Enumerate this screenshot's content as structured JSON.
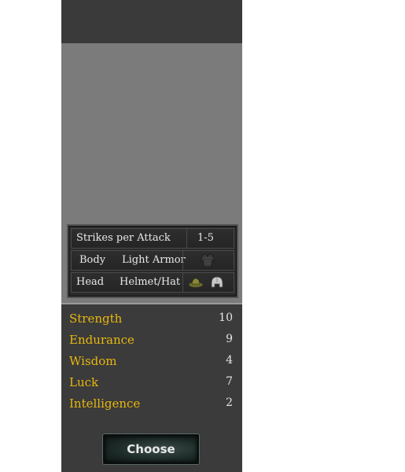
{
  "equipment": {
    "strikes_label": "Strikes per Attack",
    "strikes_value": "1-5",
    "body_slot": "Body",
    "body_item": "Light Armor",
    "head_slot": "Head",
    "head_item": "Helmet/Hat",
    "body_icon": "light-armor-icon",
    "head_icons": [
      "hat-icon",
      "helmet-icon"
    ]
  },
  "stats": [
    {
      "label": "Strength",
      "value": "10"
    },
    {
      "label": "Endurance",
      "value": "9"
    },
    {
      "label": "Wisdom",
      "value": "4"
    },
    {
      "label": "Luck",
      "value": "7"
    },
    {
      "label": "Intelligence",
      "value": "2"
    }
  ],
  "actions": {
    "choose_label": "Choose"
  },
  "colors": {
    "stat_label": "#e8b70f",
    "panel_bg": "#3b3b3b",
    "portrait_bg": "#7b7b7b"
  }
}
